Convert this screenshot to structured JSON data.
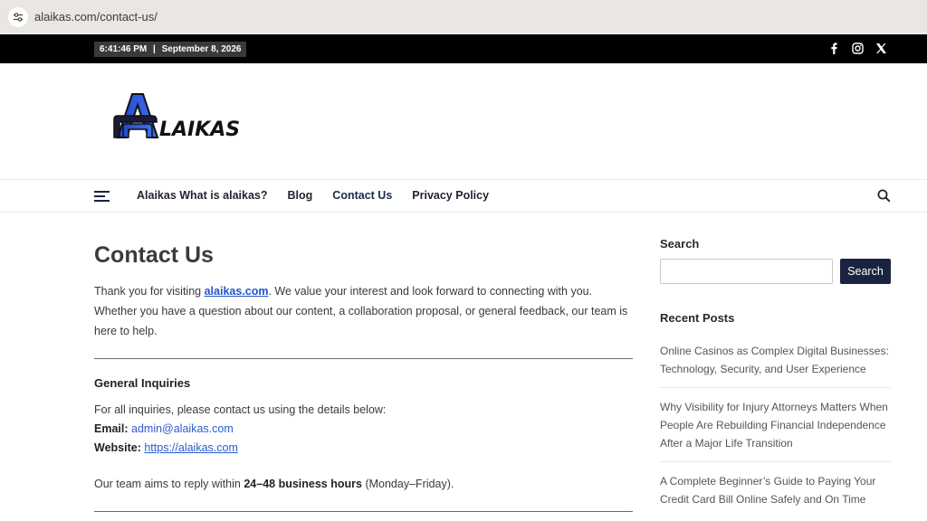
{
  "browser": {
    "url": "alaikas.com/contact-us/"
  },
  "topbar": {
    "time": "6:41:46 PM",
    "separator": "|",
    "date": "September 8, 2026",
    "socials": [
      "facebook-icon",
      "instagram-icon",
      "x-icon"
    ]
  },
  "logo": {
    "text": "LAIKAS",
    "brand_color": "#2a4fd6"
  },
  "nav": {
    "items": [
      {
        "label": "Alaikas What is alaikas?"
      },
      {
        "label": "Blog"
      },
      {
        "label": "Contact Us"
      },
      {
        "label": "Privacy Policy"
      }
    ]
  },
  "main": {
    "title": "Contact Us",
    "intro_before": "Thank you for visiting ",
    "intro_link": "alaikas.com",
    "intro_after": ". We value your interest and look forward to connecting with you. Whether you have a question about our content, a collaboration proposal, or general feedback, our team is here to help.",
    "section_title": "General Inquiries",
    "section_intro": "For all inquiries, please contact us using the details below:",
    "email_label": "Email:",
    "email_value": "admin@alaikas.com",
    "website_label": "Website:",
    "website_value": "https://alaikas.com",
    "reply_before": "Our team aims to reply within ",
    "reply_bold": "24–48 business hours",
    "reply_after": " (Monday–Friday)."
  },
  "sidebar": {
    "search_heading": "Search",
    "search_button": "Search",
    "search_value": "",
    "recent_heading": "Recent Posts",
    "posts": [
      {
        "title": "Online Casinos as Complex Digital Businesses: Technology, Security, and User Experience"
      },
      {
        "title": "Why Visibility for Injury Attorneys Matters When People Are Rebuilding Financial Independence After a Major Life Transition"
      },
      {
        "title": "A Complete Beginner’s Guide to Paying Your Credit Card Bill Online Safely and On Time"
      }
    ]
  },
  "colors": {
    "dark_navy": "#1a2340",
    "link": "#2b5bd1",
    "topbar": "#000000"
  }
}
